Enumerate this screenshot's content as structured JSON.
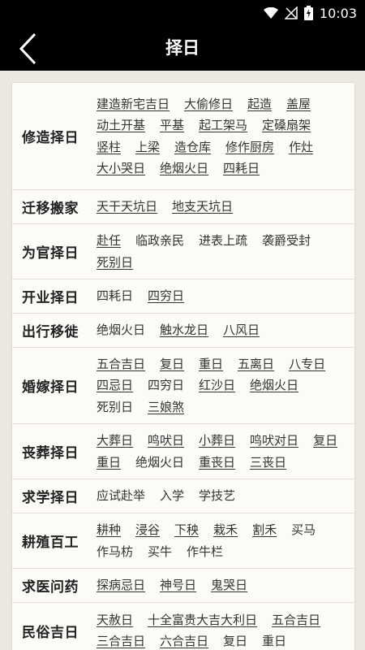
{
  "status_bar": {
    "time": "10:03"
  },
  "header": {
    "title": "择日"
  },
  "categories": [
    {
      "name": "修造择日",
      "items": [
        {
          "label": "建造新宅吉日",
          "link": true
        },
        {
          "label": "大偷修日",
          "link": true
        },
        {
          "label": "起造",
          "link": true
        },
        {
          "label": "盖屋",
          "link": true
        },
        {
          "label": "动土开基",
          "link": true
        },
        {
          "label": "平基",
          "link": true
        },
        {
          "label": "起工架马",
          "link": true
        },
        {
          "label": "定磉扇架",
          "link": true
        },
        {
          "label": "竖柱",
          "link": true
        },
        {
          "label": "上梁",
          "link": true
        },
        {
          "label": "造仓库",
          "link": true
        },
        {
          "label": "修作厨房",
          "link": true
        },
        {
          "label": "作灶",
          "link": true
        },
        {
          "label": "大小哭日",
          "link": true
        },
        {
          "label": "绝烟火日",
          "link": true
        },
        {
          "label": "四耗日",
          "link": true
        }
      ]
    },
    {
      "name": "迁移搬家",
      "items": [
        {
          "label": "天干天坑日",
          "link": true
        },
        {
          "label": "地支天坑日",
          "link": true
        }
      ]
    },
    {
      "name": "为官择日",
      "items": [
        {
          "label": "赴任",
          "link": true
        },
        {
          "label": "临政亲民",
          "link": false
        },
        {
          "label": "进表上疏",
          "link": false
        },
        {
          "label": "袭爵受封",
          "link": false
        },
        {
          "label": "死别日",
          "link": true
        }
      ]
    },
    {
      "name": "开业择日",
      "items": [
        {
          "label": "四耗日",
          "link": false
        },
        {
          "label": "四穷日",
          "link": true
        }
      ]
    },
    {
      "name": "出行移徙",
      "items": [
        {
          "label": "绝烟火日",
          "link": false
        },
        {
          "label": "触水龙日",
          "link": true
        },
        {
          "label": "八风日",
          "link": true
        }
      ]
    },
    {
      "name": "婚嫁择日",
      "items": [
        {
          "label": "五合吉日",
          "link": true
        },
        {
          "label": "复日",
          "link": true
        },
        {
          "label": "重日",
          "link": true
        },
        {
          "label": "五离日",
          "link": true
        },
        {
          "label": "八专日",
          "link": true
        },
        {
          "label": "四忌日",
          "link": true
        },
        {
          "label": "四穷日",
          "link": false
        },
        {
          "label": "红沙日",
          "link": true
        },
        {
          "label": "绝烟火日",
          "link": true
        },
        {
          "label": "死别日",
          "link": false
        },
        {
          "label": "三娘煞",
          "link": true
        }
      ]
    },
    {
      "name": "丧葬择日",
      "items": [
        {
          "label": "大葬日",
          "link": true
        },
        {
          "label": "鸣吠日",
          "link": true
        },
        {
          "label": "小葬日",
          "link": true
        },
        {
          "label": "鸣吠对日",
          "link": true
        },
        {
          "label": "复日",
          "link": true
        },
        {
          "label": "重日",
          "link": true
        },
        {
          "label": "绝烟火日",
          "link": false
        },
        {
          "label": "重丧日",
          "link": true
        },
        {
          "label": "三丧日",
          "link": true
        }
      ]
    },
    {
      "name": "求学择日",
      "items": [
        {
          "label": "应试赴举",
          "link": false
        },
        {
          "label": "入学",
          "link": false
        },
        {
          "label": "学技艺",
          "link": false
        }
      ]
    },
    {
      "name": "耕殖百工",
      "items": [
        {
          "label": "耕种",
          "link": true
        },
        {
          "label": "浸谷",
          "link": true
        },
        {
          "label": "下秧",
          "link": true
        },
        {
          "label": "栽禾",
          "link": true
        },
        {
          "label": "割禾",
          "link": true
        },
        {
          "label": "买马",
          "link": false
        },
        {
          "label": "作马枋",
          "link": false
        },
        {
          "label": "买牛",
          "link": false
        },
        {
          "label": "作牛栏",
          "link": false
        }
      ]
    },
    {
      "name": "求医问药",
      "items": [
        {
          "label": "探病忌日",
          "link": true
        },
        {
          "label": "神号日",
          "link": true
        },
        {
          "label": "鬼哭日",
          "link": true
        }
      ]
    },
    {
      "name": "民俗吉日",
      "items": [
        {
          "label": "天赦日",
          "link": true
        },
        {
          "label": "十全富贵大吉大利日",
          "link": true
        },
        {
          "label": "五合吉日",
          "link": true
        },
        {
          "label": "三合吉日",
          "link": true
        },
        {
          "label": "六合吉日",
          "link": true
        },
        {
          "label": "复日",
          "link": false
        },
        {
          "label": "重日",
          "link": false
        }
      ]
    }
  ]
}
